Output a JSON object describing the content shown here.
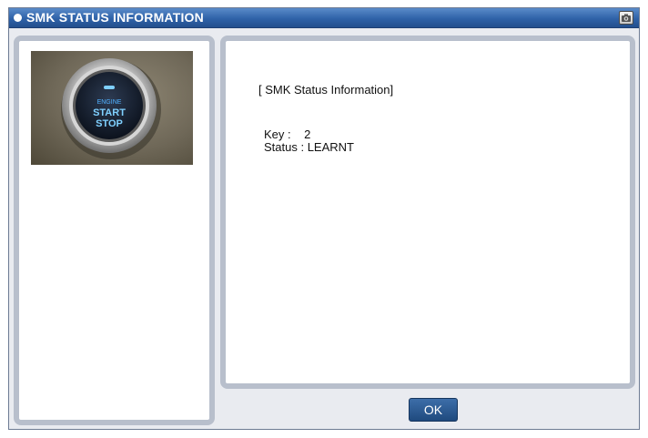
{
  "window": {
    "title": "SMK STATUS INFORMATION",
    "camera_icon": "camera-icon"
  },
  "image": {
    "button_text": [
      "ENGINE",
      "START",
      "STOP"
    ]
  },
  "info": {
    "heading": "[ SMK Status Information]",
    "key_label": "Key :",
    "key_value": "2",
    "status_label": "Status :",
    "status_value": "LEARNT"
  },
  "actions": {
    "ok_label": "OK"
  },
  "colors": {
    "title_bar": "#2f62a8",
    "panel_border": "#b8bfcc",
    "ok_button": "#2a5990",
    "glow": "#7fd0ff"
  }
}
